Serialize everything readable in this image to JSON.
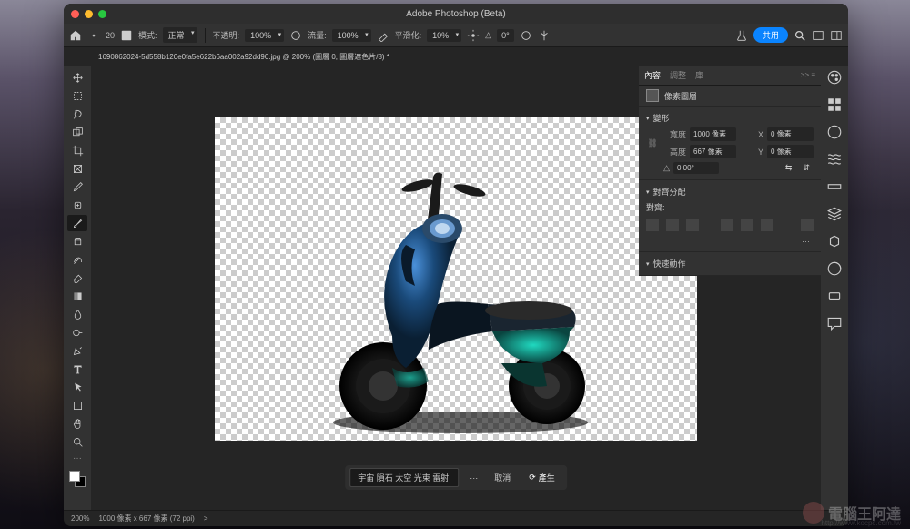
{
  "title": "Adobe Photoshop (Beta)",
  "optionsBar": {
    "brushSize": "20",
    "modeLabel": "模式:",
    "mode": "正常",
    "opacityLabel": "不透明:",
    "opacity": "100%",
    "flowLabel": "流量:",
    "flow": "100%",
    "smoothLabel": "平滑化:",
    "smooth": "10%",
    "angleLabel": "△",
    "angle": "0°",
    "share": "共用"
  },
  "tab": "1690862024-5d558b120e0fa5e622b6aa002a92dd90.jpg @ 200% (圖層 0, 圖層遮色片/8) *",
  "genFill": {
    "prompt": "宇宙 隕石 太空 光束 雷射",
    "more": "···",
    "cancel": "取消",
    "generate": "產生"
  },
  "panel": {
    "tabs": {
      "content": "內容",
      "adjust": "調整",
      "lib": "庫"
    },
    "layerType": "像素圖層",
    "transform": {
      "header": "變形",
      "widthLabel": "寬度",
      "width": "1000 像素",
      "xLabel": "X",
      "x": "0 像素",
      "heightLabel": "高度",
      "height": "667 像素",
      "yLabel": "Y",
      "y": "0 像素",
      "angleLabel": "△",
      "angle": "0.00°"
    },
    "align": {
      "header": "對齊分配",
      "label": "對齊:"
    },
    "quickActions": {
      "header": "快速動作"
    },
    "more": "···",
    "collapse": ">> ≡"
  },
  "statusBar": {
    "zoom": "200%",
    "docInfo": "1000 像素 x 667 像素 (72 ppi)",
    "chevron": ">"
  },
  "watermark": {
    "text": "電腦王阿達",
    "url": "http://www.kocpc.com.tw"
  }
}
